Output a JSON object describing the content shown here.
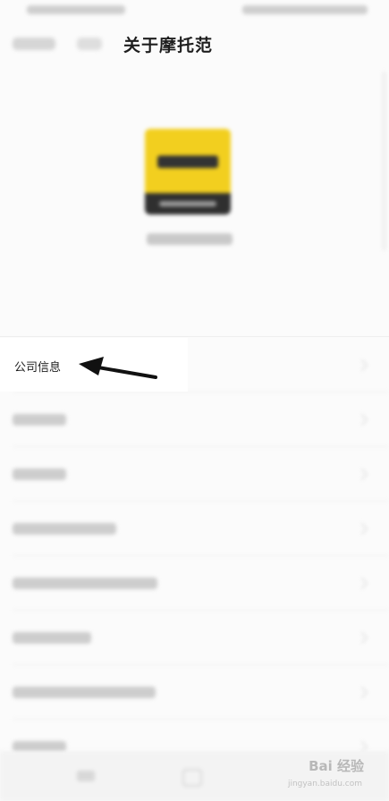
{
  "nav": {
    "title": "关于摩托范",
    "back_icon": "back-icon",
    "close_icon": "close-icon"
  },
  "app": {
    "logo_icon": "motofan-logo",
    "logo_color": "#f2cf1f"
  },
  "list": {
    "items": [
      {
        "label": "公司信息"
      },
      {
        "label": ""
      },
      {
        "label": ""
      },
      {
        "label": ""
      },
      {
        "label": ""
      },
      {
        "label": ""
      },
      {
        "label": ""
      },
      {
        "label": ""
      }
    ]
  },
  "annotation": {
    "arrow_icon": "pointer-arrow-icon"
  },
  "watermark": {
    "text": "Bai 经验",
    "sub": "jingyan.baidu.com"
  }
}
